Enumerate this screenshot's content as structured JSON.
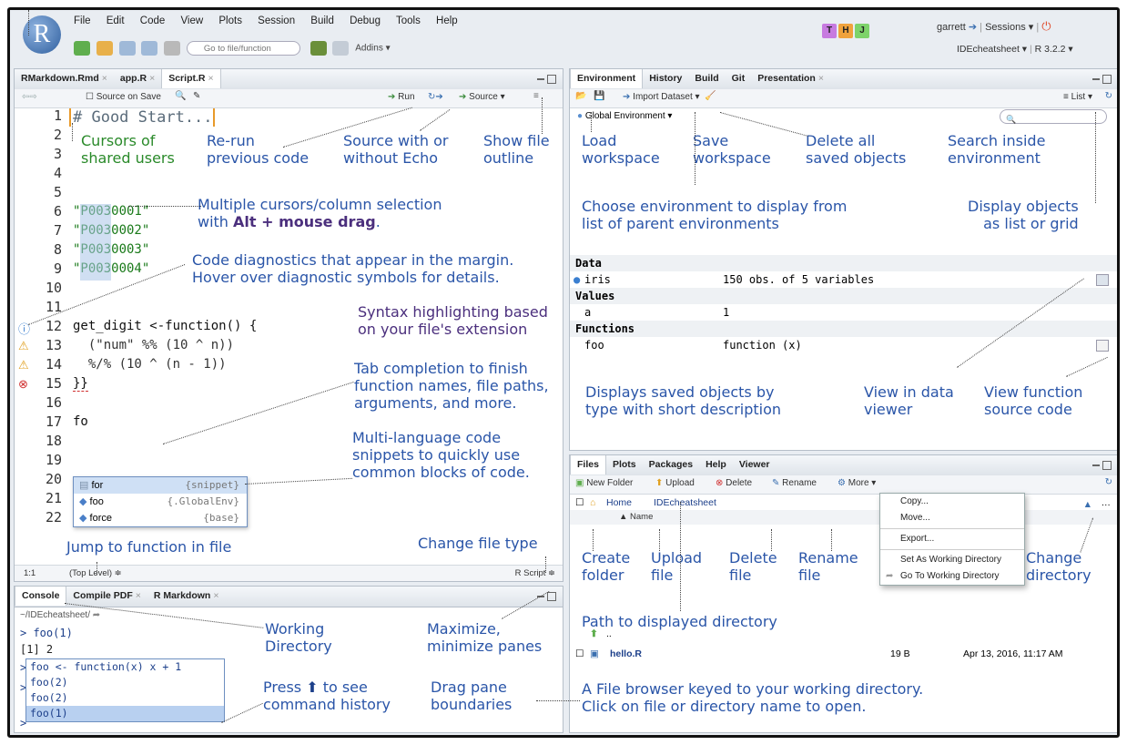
{
  "menubar": {
    "items": [
      "File",
      "Edit",
      "Code",
      "View",
      "Plots",
      "Session",
      "Build",
      "Debug",
      "Tools",
      "Help"
    ]
  },
  "toolbar": {
    "goto_placeholder": "Go to file/function",
    "addins": "Addins ▾"
  },
  "users": {
    "t": "T",
    "h": "H",
    "j": "J",
    "t_color": "#c77be0",
    "h_color": "#f0a23c",
    "j_color": "#7dd36a"
  },
  "account": {
    "user": "garrett",
    "sessions": "Sessions ▾",
    "project": "IDEcheatsheet ▾",
    "r_version": "R 3.2.2 ▾"
  },
  "editor": {
    "tabs": [
      {
        "label": "RMarkdown.Rmd"
      },
      {
        "label": "app.R"
      },
      {
        "label": "Script.R"
      }
    ],
    "source_on_save": "Source on Save",
    "run": "Run",
    "source": "Source ▾",
    "line_numbers": [
      "1",
      "2",
      "3",
      "4",
      "5",
      "6",
      "7",
      "8",
      "9",
      "10",
      "11",
      "12",
      "13",
      "14",
      "15",
      "16",
      "17",
      "18",
      "19",
      "20",
      "21",
      "22"
    ],
    "code": {
      "l1": "# Good Start...",
      "l6": "\"P0030001\"",
      "l7": "\"P0030002\"",
      "l8": "\"P0030003\"",
      "l9": "\"P0030004\"",
      "l12": "get_digit <-function() {",
      "l13": "  (\"num\" %% (10 ^ n))",
      "l14": "  %/% (10 ^ (n - 1))",
      "l15": "}}",
      "l17": "fo"
    },
    "autocomplete": [
      {
        "name": "for",
        "src": "{snippet}"
      },
      {
        "name": "foo",
        "src": "{.GlobalEnv}"
      },
      {
        "name": "force",
        "src": "{base}"
      }
    ],
    "status_pos": "1:1",
    "status_scope": "(Top Level) ≑",
    "status_type": "R Script ≑"
  },
  "editor_notes": {
    "cursors": "Cursors of\nshared users",
    "rerun": "Re-run\nprevious code",
    "source_echo": "Source with or\nwithout Echo",
    "outline": "Show file\noutline",
    "multicursor_1": "Multiple cursors/column selection",
    "multicursor_2": "with ",
    "multicursor_bold": "Alt + mouse drag",
    ".": ".",
    "diag_1": "Code diagnostics that appear in the margin.",
    "diag_2": "Hover over diagnostic symbols for details.",
    "syntax_1": "Syntax highlighting based",
    "syntax_2": "on your file's extension",
    "tab_1": "Tab completion to finish",
    "tab_2": "function names, file paths,",
    "tab_3": "arguments, and more.",
    "snip_1": "Multi-language code",
    "snip_2": "snippets to quickly use",
    "snip_3": "common blocks of code.",
    "jump": "Jump to function in file",
    "ftype": "Change file type"
  },
  "console": {
    "tabs": [
      {
        "label": "Console"
      },
      {
        "label": "Compile PDF"
      },
      {
        "label": "R Markdown"
      }
    ],
    "path": "~/IDEcheatsheet/",
    "lines": [
      "> foo(1)",
      "[1] 2"
    ],
    "history": [
      "foo <- function(x) x + 1",
      "foo(2)",
      "foo(2)",
      "foo(1)"
    ],
    "notes": {
      "wd1": "Working",
      "wd2": "Directory",
      "max1": "Maximize,",
      "max2": "minimize panes",
      "press1": "Press ",
      "press2": " to see",
      "press3": "command history",
      "drag1": "Drag pane",
      "drag2": "boundaries"
    }
  },
  "environment": {
    "tabs": [
      {
        "label": "Environment"
      },
      {
        "label": "History"
      },
      {
        "label": "Build"
      },
      {
        "label": "Git"
      },
      {
        "label": "Presentation"
      }
    ],
    "import": "Import Dataset ▾",
    "view_mode": "List ▾",
    "env_select": "Global Environment ▾",
    "sections": {
      "data": "Data",
      "values": "Values",
      "functions": "Functions"
    },
    "rows": {
      "iris_name": "iris",
      "iris_desc": "150 obs. of 5 variables",
      "a_name": "a",
      "a_val": "1",
      "foo_name": "foo",
      "foo_val": "function (x)"
    },
    "notes": {
      "load1": "Load",
      "load2": "workspace",
      "save1": "Save",
      "save2": "workspace",
      "del1": "Delete all",
      "del2": "saved objects",
      "search1": "Search inside",
      "search2": "environment",
      "choose1": "Choose environment to display from",
      "choose2": "list of parent environments",
      "disp1": "Display objects",
      "disp2": "as list or grid",
      "saved1": "Displays saved objects by",
      "saved2": "type with short description",
      "vd1": "View in data",
      "vd2": "viewer",
      "vf1": "View function",
      "vf2": "source code"
    }
  },
  "files": {
    "tabs": [
      {
        "label": "Files"
      },
      {
        "label": "Plots"
      },
      {
        "label": "Packages"
      },
      {
        "label": "Help"
      },
      {
        "label": "Viewer"
      }
    ],
    "toolbar": {
      "new_folder": "New Folder",
      "upload": "Upload",
      "delete": "Delete",
      "rename": "Rename",
      "more": "More ▾"
    },
    "crumbs": {
      "home": "Home",
      "dir": "IDEcheatsheet"
    },
    "col_name": "▲ Name",
    "menu": {
      "copy": "Copy...",
      "move": "Move...",
      "export": "Export...",
      "setwd": "Set As Working Directory",
      "gotowd": "Go To Working Directory"
    },
    "up": "..",
    "file": {
      "name": "hello.R",
      "size": "19 B",
      "modified": "Apr 13, 2016, 11:17 AM"
    },
    "notes": {
      "create1": "Create",
      "create2": "folder",
      "upload1": "Upload",
      "upload2": "file",
      "delete1": "Delete",
      "delete2": "file",
      "rename1": "Rename",
      "rename2": "file",
      "chdir1": "Change",
      "chdir2": "directory",
      "path": "Path to displayed directory",
      "browser1": "A File browser keyed to your working directory.",
      "browser2": "Click on file or directory name to open."
    }
  }
}
